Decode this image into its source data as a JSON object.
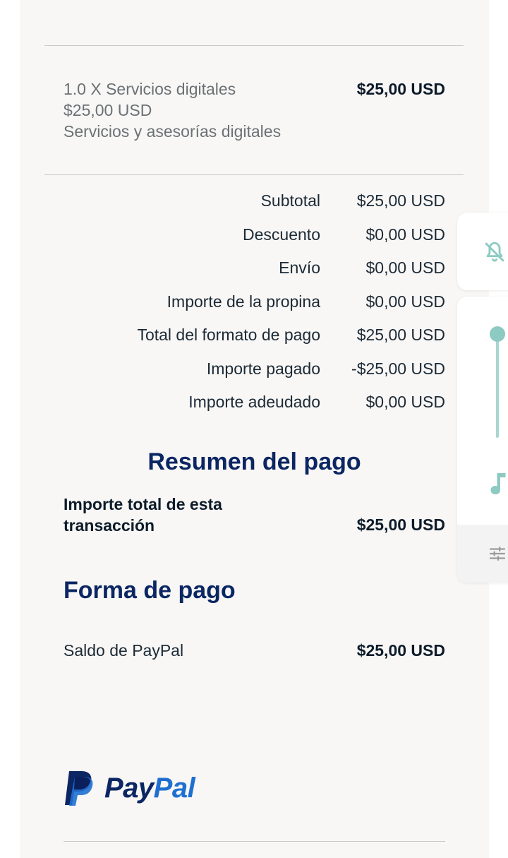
{
  "item": {
    "line1": "1.0 X Servicios digitales",
    "line2": "$25,00 USD",
    "line3": "Servicios y asesorías digitales",
    "price": "$25,00 USD"
  },
  "summary": [
    {
      "label": "Subtotal",
      "value": "$25,00 USD"
    },
    {
      "label": "Descuento",
      "value": "$0,00 USD"
    },
    {
      "label": "Envío",
      "value": "$0,00 USD"
    },
    {
      "label": "Importe de la propina",
      "value": "$0,00 USD"
    },
    {
      "label": "Total del formato de pago",
      "value": "$25,00 USD"
    },
    {
      "label": "Importe pagado",
      "value": "-$25,00 USD"
    },
    {
      "label": "Importe adeudado",
      "value": "$0,00 USD"
    }
  ],
  "payment_summary": {
    "heading": "Resumen del pago",
    "total_label_line1": "Importe total de esta",
    "total_label_line2": "transacción",
    "total_value": "$25,00 USD"
  },
  "payment_method": {
    "heading": "Forma de pago",
    "method_label": "Saldo de PayPal",
    "method_value": "$25,00 USD"
  },
  "logo": {
    "word_pay": "Pay",
    "word_pal": "Pal"
  },
  "volume_overlay": {
    "level": 1.0,
    "icons": [
      "bell-off-icon",
      "music-note-icon",
      "tune-icon"
    ],
    "accent": "#8ccac2"
  },
  "colors": {
    "heading": "#0b2663",
    "paypal_dark": "#0b2663",
    "paypal_light": "#1f6fd1",
    "card_bg": "#f8f7f5"
  }
}
